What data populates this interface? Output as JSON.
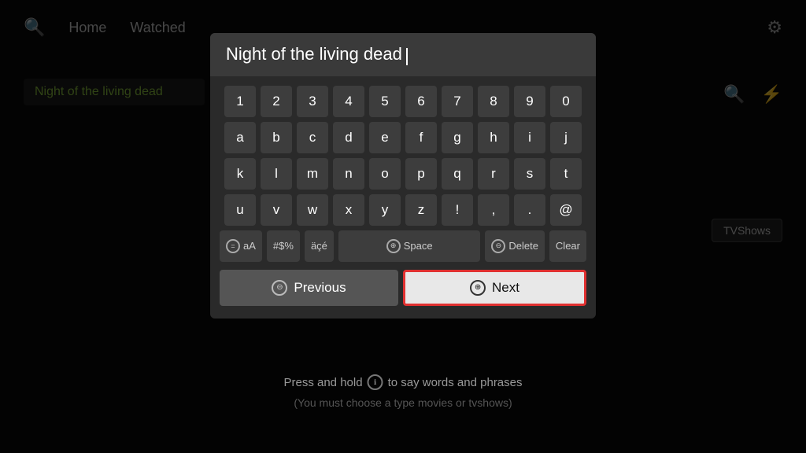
{
  "nav": {
    "search_icon": "🔍",
    "home_label": "Home",
    "watched_label": "Watched",
    "settings_icon": "⚙"
  },
  "background": {
    "search_placeholder": "Night of the living dead",
    "tvshows_label": "TVShows"
  },
  "modal": {
    "input_value": "Night of the living dead",
    "rows": {
      "numbers": [
        "1",
        "2",
        "3",
        "4",
        "5",
        "6",
        "7",
        "8",
        "9",
        "0"
      ],
      "row1": [
        "a",
        "b",
        "c",
        "d",
        "e",
        "f",
        "g",
        "h",
        "i",
        "j"
      ],
      "row2": [
        "k",
        "l",
        "m",
        "n",
        "o",
        "p",
        "q",
        "r",
        "s",
        "t"
      ],
      "row3": [
        "u",
        "v",
        "w",
        "x",
        "y",
        "z",
        "!",
        ",",
        ".",
        "@"
      ]
    },
    "special_keys": {
      "symbols_label": "aA",
      "hash_label": "#$%",
      "accent_label": "äçé",
      "space_label": "Space",
      "delete_label": "Delete",
      "clear_label": "Clear"
    },
    "prev_label": "Previous",
    "next_label": "Next"
  },
  "hints": {
    "hold_text": "Press and hold",
    "hold_suffix": "to say words and phrases",
    "sub_hint": "(You must choose a type movies or tvshows)"
  }
}
